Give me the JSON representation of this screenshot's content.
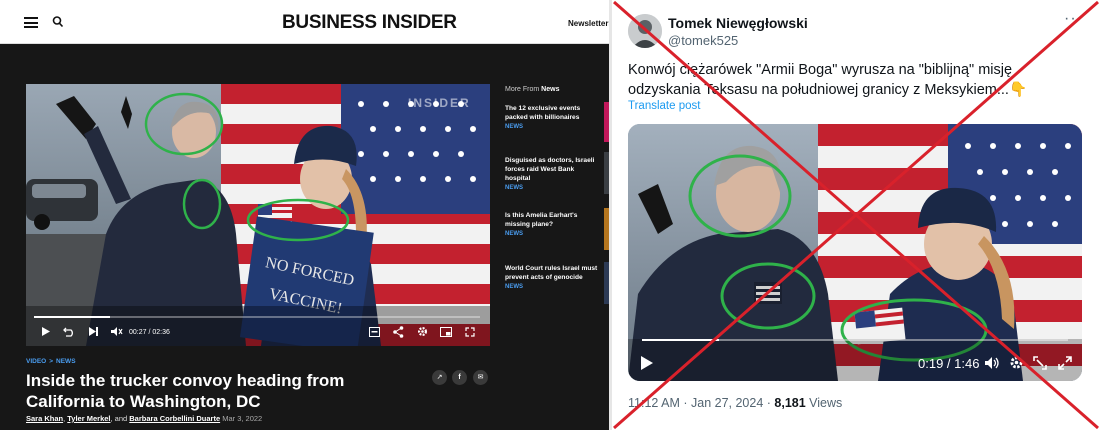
{
  "business_insider": {
    "logo": "BUSINESS INSIDER",
    "newsletters": "Newsletters",
    "video": {
      "watermark": "INSIDER",
      "sign_line1": "NO FORCED",
      "sign_line2": "VACCINE!",
      "time": "00:27 / 02:36",
      "progress": 0.17
    },
    "more_from": {
      "prefix": "More From ",
      "brand": "News"
    },
    "stories": [
      {
        "title": "The 12 exclusive events packed with billionaires",
        "tag": "NEWS"
      },
      {
        "title": "Disguised as doctors, Israeli forces raid West Bank hospital",
        "tag": "NEWS"
      },
      {
        "title": "Is this Amelia Earhart's missing plane?",
        "tag": "NEWS"
      },
      {
        "title": "World Court rules Israel must prevent acts of genocide",
        "tag": "NEWS"
      }
    ],
    "breadcrumb": {
      "first": "VIDEO",
      "separator": ">",
      "second": "NEWS"
    },
    "headline": "Inside the trucker convoy heading from California to Washington, DC",
    "byline": {
      "author1": "Sara Khan",
      "sep1": ", ",
      "author2": "Tyler Merkel",
      "sep2": ", and ",
      "author3": "Barbara Corbellini Duarte",
      "date": " Mar 3, 2022"
    }
  },
  "x_post": {
    "name": "Tomek Niewęgłowski",
    "handle": "@tomek525",
    "text": "Konwój ciężarówek \"Armii Boga\" wyrusza na \"biblijną\" misję odzyskania Teksasu na południowej granicy z Meksykiem...👇",
    "translate": "Translate post",
    "video_time": "0:19 / 1:46",
    "time": "11:12 AM",
    "date_sep": " · ",
    "date": "Jan 27, 2024",
    "views_sep": " · ",
    "views": "8,181",
    "views_label": " Views"
  },
  "colors": {
    "bi_background": "#171717",
    "accent_link": "#4a9df0",
    "x_blue": "#1d9bf0",
    "highlight_green": "#2fb24a",
    "cross_red": "#d9212b"
  }
}
